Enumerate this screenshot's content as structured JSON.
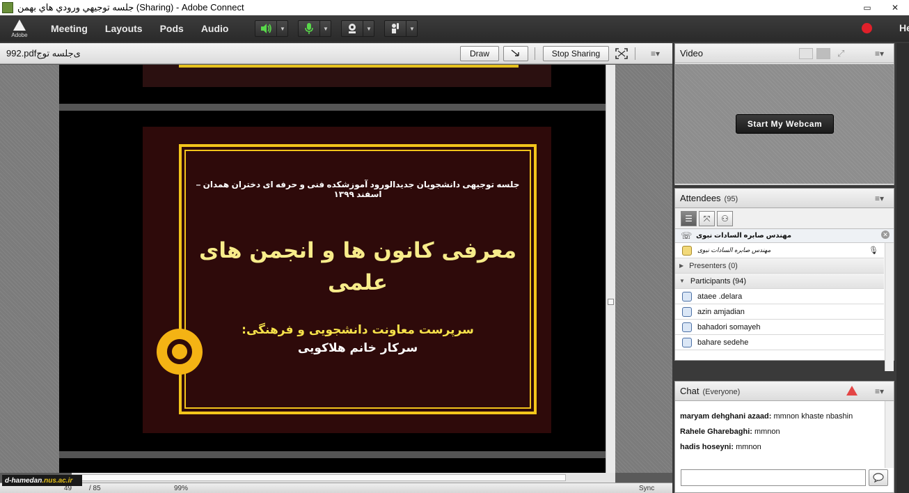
{
  "window": {
    "title": "جلسه توجيهي ورودي هاي بهمن (Sharing) - Adobe Connect",
    "restore_glyph": "▭",
    "close_glyph": "✕"
  },
  "menubar": {
    "logo_text": "Adobe",
    "items": [
      "Meeting",
      "Layouts",
      "Pods",
      "Audio"
    ],
    "help": "He",
    "icons": {
      "speaker": "speaker-icon",
      "mic": "microphone-icon",
      "camera": "webcam-icon",
      "raise_hand": "raise-hand-icon"
    },
    "record_color": "#e0202a"
  },
  "share_pod": {
    "title": "992.pdfی‌جلسه توج",
    "draw_label": "Draw",
    "stop_sharing_label": "Stop Sharing",
    "menu_glyph": "≡▾",
    "slide": {
      "header_text": "جلسه توجیهی دانشجویان جدیدالورود آموزشکده فنی و حرفه ای دختران همدان – اسفند ۱۳۹۹",
      "main_title_line1": "معرفی کانون ها و انجمن های",
      "main_title_line2": "علمی",
      "subtitle_line1": "سرپرست معاونت دانشجویی و فرهنگی:",
      "subtitle_line2": "سرکار خانم هلاکویی",
      "frame_color": "#f3c51b",
      "background_color": "#2e0a0a"
    },
    "footer": {
      "page_value": "49",
      "page_total": "/ 85",
      "zoom_value": "99%",
      "sync_label": "Sync"
    }
  },
  "watermark": {
    "prefix": "d-hamedan",
    "highlight": ".nus.ac.ir"
  },
  "video_pod": {
    "title": "Video",
    "webcam_button": "Start My Webcam",
    "menu_glyph": "≡▾"
  },
  "attendees_pod": {
    "title": "Attendees",
    "count": "(95)",
    "menu_glyph": "≡▾",
    "host_row": "مهندس صابره السادات نبوی",
    "host_sub": "مهندس صابره السادات نبوی",
    "presenters": "Presenters (0)",
    "participants": "Participants (94)",
    "people": [
      "ataee .delara",
      "azin amjadian",
      "bahadori somayeh",
      "bahare sedehe"
    ]
  },
  "chat_pod": {
    "title": "Chat",
    "scope": "(Everyone)",
    "menu_glyph": "≡▾",
    "messages": [
      {
        "sender": "maryam dehghani azaad:",
        "text": "mmnon khaste nbashin"
      },
      {
        "sender": "Rahele Gharebaghi:",
        "text": "mmnon"
      },
      {
        "sender": "hadis hoseyni:",
        "text": "mmnon"
      }
    ],
    "input_placeholder": ""
  }
}
